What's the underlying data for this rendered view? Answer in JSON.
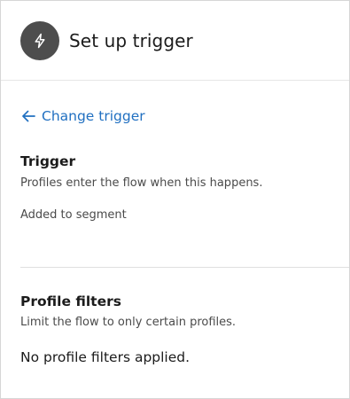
{
  "header": {
    "title": "Set up trigger",
    "icon": "lightning-bolt-icon"
  },
  "back_link": {
    "label": "Change trigger",
    "color": "#2170c1"
  },
  "trigger_section": {
    "title": "Trigger",
    "description": "Profiles enter the flow when this happens.",
    "value": "Added to segment"
  },
  "filters_section": {
    "title": "Profile filters",
    "description": "Limit the flow to only certain profiles.",
    "empty_text": "No profile filters applied."
  }
}
